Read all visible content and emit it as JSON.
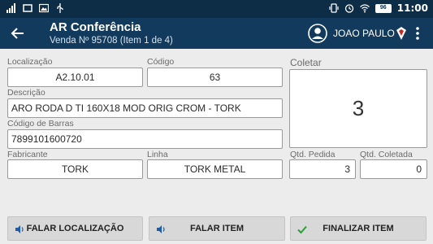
{
  "statusbar": {
    "time": "11:00",
    "battery": "96"
  },
  "appbar": {
    "title": "AR Conferência",
    "subtitle": "Venda Nº 95708 (Item 1 de 4)",
    "user": "JOAO PAULO"
  },
  "form": {
    "localizacao": {
      "label": "Localização",
      "value": "A2.10.01"
    },
    "codigo": {
      "label": "Código",
      "value": "63"
    },
    "descricao": {
      "label": "Descrição",
      "value": "ARO RODA D TI 160X18 MOD ORIG CROM - TORK"
    },
    "codigo_barras": {
      "label": "Código de Barras",
      "value": "7899101600720"
    },
    "fabricante": {
      "label": "Fabricante",
      "value": "TORK"
    },
    "linha": {
      "label": "Linha",
      "value": "TORK METAL"
    },
    "coletar": {
      "label": "Coletar",
      "value": "3"
    },
    "qtd_pedida": {
      "label": "Qtd. Pedida",
      "value": "3"
    },
    "qtd_coletada": {
      "label": "Qtd. Coletada",
      "value": "0"
    }
  },
  "buttons": {
    "falar_localizacao": "FALAR LOCALIZAÇÃO",
    "falar_item": "FALAR ITEM",
    "finalizar_item": "FINALIZAR ITEM"
  },
  "colors": {
    "statusbar": "#0d2c45",
    "appbar": "#123a5c",
    "background": "#ececec",
    "check": "#2e9d3a",
    "flag_red": "#c62828"
  }
}
